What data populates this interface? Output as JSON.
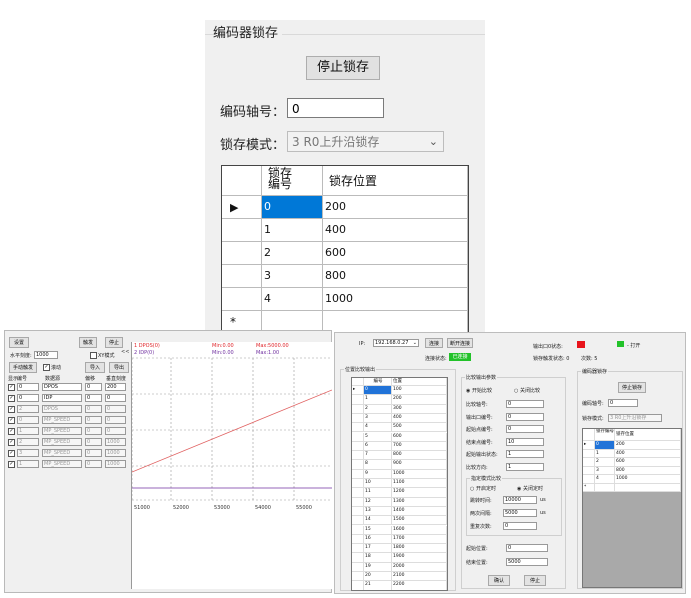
{
  "zoom": {
    "title": "编码器锁存",
    "stop_button": "停止锁存",
    "axis_label": "编码轴号：",
    "axis_value": "0",
    "mode_label": "锁存模式：",
    "mode_value": "3 R0上升沿锁存",
    "grid": {
      "col1": "锁存编号",
      "col1_line1": "锁存",
      "col1_line2": "编号",
      "col2": "锁存位置",
      "rows": [
        {
          "num": "0",
          "pos": "200"
        },
        {
          "num": "1",
          "pos": "400"
        },
        {
          "num": "2",
          "pos": "600"
        },
        {
          "num": "3",
          "pos": "800"
        },
        {
          "num": "4",
          "pos": "1000"
        }
      ],
      "new_row_marker": "*"
    }
  },
  "scope": {
    "buttons": {
      "set": "设置",
      "trigger": "触发",
      "stop": "停止",
      "manual": "手动触发",
      "import": "导入",
      "export": "导出"
    },
    "h_scale_label": "水平刻度:",
    "h_scale_value": "1000",
    "xy_mode_label": "XY模式",
    "arrow_label": "<<",
    "scroll_label": "滚动",
    "headers": {
      "show": "显示",
      "index": "编号",
      "source": "数据源",
      "offset": "偏移",
      "scale": "垂直刻度"
    },
    "channels": [
      {
        "idx": "0",
        "src": "DPOS",
        "off": "0",
        "scale": "200",
        "enabled": true
      },
      {
        "idx": "0",
        "src": "IDP",
        "off": "0",
        "scale": "0",
        "enabled": true
      },
      {
        "idx": "2",
        "src": "DPOS",
        "off": "0",
        "scale": "0",
        "enabled": false
      },
      {
        "idx": "0",
        "src": "MP_SPEED",
        "off": "0",
        "scale": "0",
        "enabled": false
      },
      {
        "idx": "1",
        "src": "MP_SPEED",
        "off": "0",
        "scale": "0",
        "enabled": false
      },
      {
        "idx": "2",
        "src": "MP_SPEED",
        "off": "0",
        "scale": "1000",
        "enabled": false
      },
      {
        "idx": "3",
        "src": "MP_SPEED",
        "off": "0",
        "scale": "1000",
        "enabled": false
      },
      {
        "idx": "1",
        "src": "MP_SPEED",
        "off": "0",
        "scale": "1000",
        "enabled": false
      }
    ],
    "plot": {
      "legend1": "1 DPOS(0)",
      "legend2": "2 IDP(0)",
      "min1": "Min:0.00",
      "max1": "Max:5000.00",
      "min2": "Min:0.00",
      "max2": "Max:1.00",
      "xticks": [
        "51000",
        "52000",
        "53000",
        "54000",
        "55000"
      ],
      "trace1_color": "#e06060",
      "trace2_color": "#7030a0"
    }
  },
  "ctrl": {
    "ip_label": "IP:",
    "ip_value": "192.168.0.27",
    "connect": "连接",
    "disconnect": "断开连接",
    "conn_state_label": "连接状态:",
    "conn_state_value": "已连接",
    "output_label": "输出口0状态:",
    "open_label": "- 打开",
    "trigger_status_label": "锁存触发状态: 0",
    "count_label": "次数: 5",
    "compare_group": "位置比较输出",
    "compare_cols": [
      "编号",
      "位置"
    ],
    "compare_rows": [
      [
        "0",
        "100"
      ],
      [
        "1",
        "200"
      ],
      [
        "2",
        "300"
      ],
      [
        "3",
        "400"
      ],
      [
        "4",
        "500"
      ],
      [
        "5",
        "600"
      ],
      [
        "6",
        "700"
      ],
      [
        "7",
        "800"
      ],
      [
        "8",
        "900"
      ],
      [
        "9",
        "1000"
      ],
      [
        "10",
        "1100"
      ],
      [
        "11",
        "1200"
      ],
      [
        "12",
        "1300"
      ],
      [
        "13",
        "1400"
      ],
      [
        "14",
        "1500"
      ],
      [
        "15",
        "1600"
      ],
      [
        "16",
        "1700"
      ],
      [
        "17",
        "1800"
      ],
      [
        "18",
        "1900"
      ],
      [
        "19",
        "2000"
      ],
      [
        "20",
        "2100"
      ],
      [
        "21",
        "2200"
      ]
    ],
    "param_group": "比较输出参数",
    "radio_on": "开始比较",
    "radio_off": "关闭比较",
    "fields": [
      {
        "label": "比较轴号:",
        "value": "0"
      },
      {
        "label": "输出口编号:",
        "value": "0"
      },
      {
        "label": "起始点编号:",
        "value": "0"
      },
      {
        "label": "结束点编号:",
        "value": "10"
      },
      {
        "label": "起始输出状态:",
        "value": "1"
      },
      {
        "label": "比较方向:",
        "value": "1"
      }
    ],
    "extra_group": "指定模式比较",
    "radio_single": "开启定时",
    "radio_close": "关闭定时",
    "extra_fields": [
      {
        "label": "跳转时间:",
        "value": "10000",
        "unit": "us"
      },
      {
        "label": "两次间隔:",
        "value": "5000",
        "unit": "us"
      },
      {
        "label": "重复次数:",
        "value": "0",
        "unit": ""
      }
    ],
    "start_label": "起始位置:",
    "start_value": "0",
    "end_label": "结束位置:",
    "end_value": "5000",
    "confirm": "确认",
    "stop": "停止",
    "latch_group": "编码器锁存",
    "latch_stop": "停止锁存",
    "latch_axis_label": "编码轴号:",
    "latch_axis_value": "0",
    "latch_mode_label": "锁存模式:",
    "latch_mode_value": "3 R0上升沿锁存",
    "latch_cols": [
      "锁存编号",
      "锁存位置"
    ],
    "latch_rows": [
      [
        "0",
        "200"
      ],
      [
        "1",
        "400"
      ],
      [
        "2",
        "600"
      ],
      [
        "3",
        "800"
      ],
      [
        "4",
        "1000"
      ]
    ],
    "colors": {
      "red": "#e8141b",
      "green": "#22c229",
      "blue": "#2173d8"
    }
  }
}
